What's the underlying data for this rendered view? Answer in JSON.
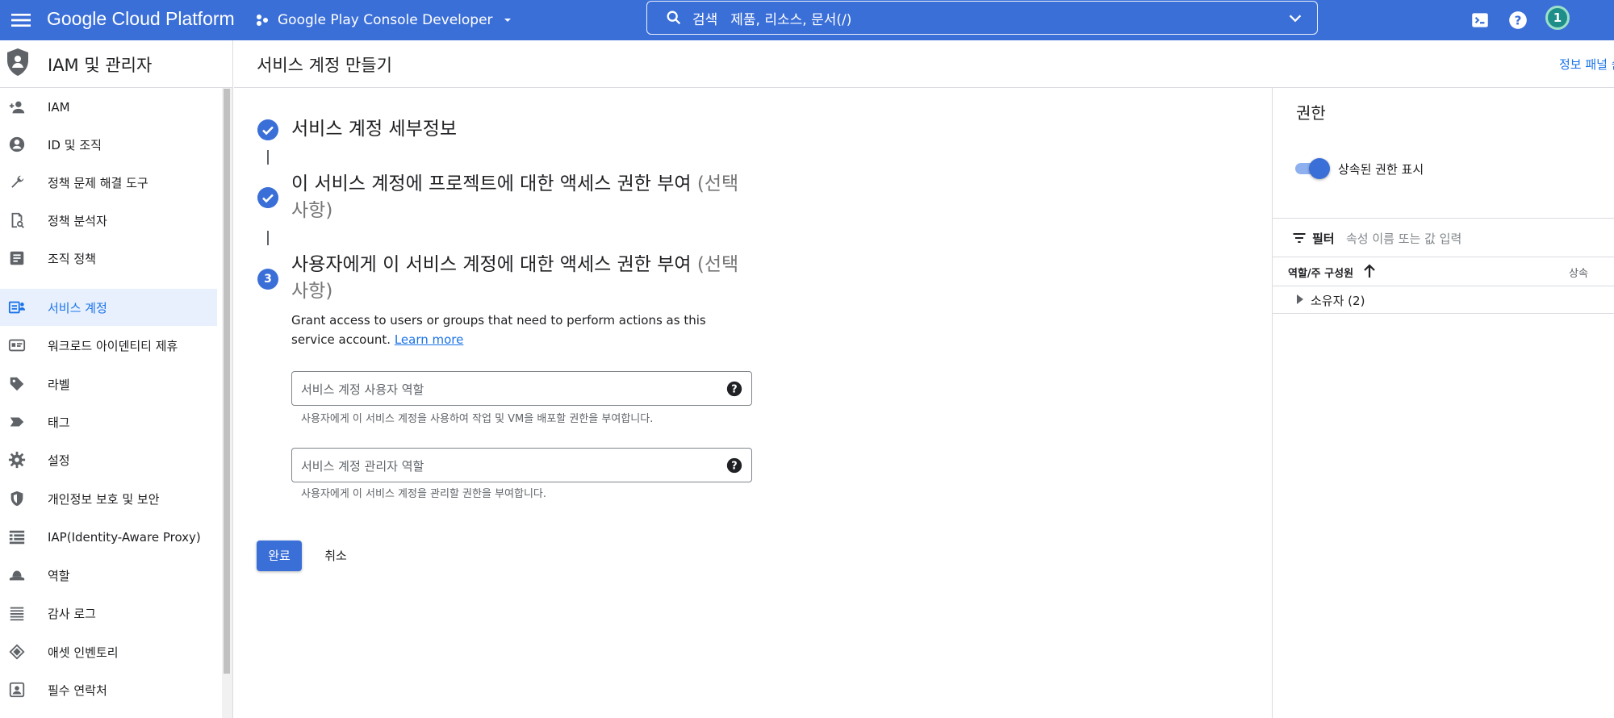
{
  "header": {
    "brand": "Google Cloud Platform",
    "project": "Google Play Console Developer",
    "search_label": "검색",
    "search_placeholder": "제품, 리소스, 문서(/)",
    "notifications_count": "1"
  },
  "sidebar": {
    "title": "IAM 및 관리자",
    "items": [
      {
        "label": "IAM",
        "icon": "person-add-icon"
      },
      {
        "label": "ID 및 조직",
        "icon": "account-circle-icon"
      },
      {
        "label": "정책 문제 해결 도구",
        "icon": "wrench-icon"
      },
      {
        "label": "정책 분석자",
        "icon": "policy-document-icon"
      },
      {
        "label": "조직 정책",
        "icon": "article-icon"
      },
      {
        "label": "서비스 계정",
        "icon": "service-account-icon",
        "active": true
      },
      {
        "label": "워크로드 아이덴티티 제휴",
        "icon": "id-card-icon"
      },
      {
        "label": "라벨",
        "icon": "label-tag-icon"
      },
      {
        "label": "태그",
        "icon": "tag-arrow-icon"
      },
      {
        "label": "설정",
        "icon": "gear-icon"
      },
      {
        "label": "개인정보 보호 및 보안",
        "icon": "shield-icon"
      },
      {
        "label": "IAP(Identity-Aware Proxy)",
        "icon": "iap-icon"
      },
      {
        "label": "역할",
        "icon": "hat-icon"
      },
      {
        "label": "감사 로그",
        "icon": "list-lines-icon"
      },
      {
        "label": "애셋 인벤토리",
        "icon": "diamond-layers-icon"
      },
      {
        "label": "필수 연락처",
        "icon": "contact-card-icon"
      }
    ]
  },
  "main": {
    "page_title": "서비스 계정 만들기",
    "info_panel_link": "정보 패널 숨",
    "steps": [
      {
        "title": "서비스 계정 세부정보",
        "optional": ""
      },
      {
        "title": "이 서비스 계정에 프로젝트에 대한 액세스 권한 부여 ",
        "optional": "(선택사항)"
      },
      {
        "number": "3",
        "title": "사용자에게 이 서비스 계정에 대한 액세스 권한 부여 ",
        "optional": "(선택사항)"
      }
    ],
    "description": "Grant access to users or groups that need to perform actions as this service account.",
    "learn_more": "Learn more",
    "field_user_role": {
      "label": "서비스 계정 사용자 역할",
      "hint": "사용자에게 이 서비스 계정을 사용하여 작업 및 VM을 배포할 권한을 부여합니다."
    },
    "field_admin_role": {
      "label": "서비스 계정 관리자 역할",
      "hint": "사용자에게 이 서비스 계정을 관리할 권한을 부여합니다."
    },
    "done_button": "완료",
    "cancel_button": "취소"
  },
  "panel": {
    "title": "권한",
    "toggle_label": "상속된 권한 표시",
    "toggle_on": true,
    "filter_label": "필터",
    "filter_placeholder": "속성 이름 또는 값 입력",
    "column_role": "역할/주 구성원",
    "column_inherited": "상속",
    "row_owner": "소유자 (2)"
  },
  "colors": {
    "topbar": "#3b6fd8",
    "accent": "#1a73e8",
    "active_bg": "#e8f0fe"
  }
}
